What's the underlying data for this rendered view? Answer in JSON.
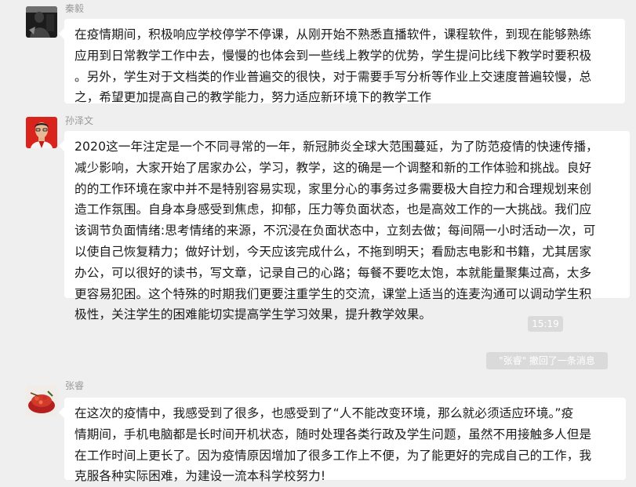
{
  "messages": [
    {
      "sender": "秦毅",
      "avatar_icon": "user-photo-dark",
      "text": "在疫情期间，积极响应学校停学不停课，从刚开始不熟悉直播软件，课程软件，到现在能够熟练\n应用到日常教学工作中去，慢慢的也体会到一些线上教学的优势，学生提问比线下教学时要积极\n。另外，学生对于文档类的作业普遍交的很快，对于需要手写分析等作业上交速度普遍较慢，总\n之，希望更加提高自己的教学能力，努力适应新环境下的教学工作"
    },
    {
      "sender": "孙泽文",
      "avatar_icon": "user-photo-red-bg",
      "text": "2020这一年注定是一个不同寻常的一年，新冠肺炎全球大范围蔓延，为了防范疫情的快速传播，\n减少影响，大家开始了居家办公，学习，教学，这的确是一个调整和新的工作体验和挑战。良好\n的的工作环境在家中并不是特别容易实现，家里分心的事务过多需要极大自控力和合理规划来创\n造工作氛围。自身本身感受到焦虑，抑郁，压力等负面状态，也是高效工作的一大挑战。我们应\n该调节负面情绪:思考情绪的来源，不沉浸在负面状态中，立刻去做；每间隔一小时活动一次，可\n以使自己恢复精力；做好计划，今天应该完成什么，不拖到明天；看励志电影和书籍，尤其居家\n办公，可以很好的读书，写文章，记录自己的心路；每餐不要吃太饱，本就能量聚集过高，太多\n更容易犯困。这个特殊的时期我们更要注重学生的交流，课堂上适当的连麦沟通可以调动学生积\n极性，关注学生的困难能切实提高学生学习效果，提升教学效果。"
    },
    {
      "sender": "张睿",
      "avatar_icon": "user-photo-food",
      "text": "在这次的疫情中，我感受到了很多，也感受到了“人不能改变环境，那么就必须适应环境。”疫\n情期间，手机电脑都是长时间开机状态，随时处理各类行政及学生问题，虽然不用接触多人但是\n在工作时间上更长了。因为疫情原因增加了很多工作上不便，为了能更好的完成自己的工作，我\n克服各种实际困难，为建设一流本科学校努力!"
    }
  ],
  "timestamp": "15:19",
  "system_notice": "\"张睿\" 撤回了一条消息",
  "colors": {
    "background": "#efefef",
    "bubble": "#ffffff",
    "sender_name": "#999999",
    "chip": "#dadada"
  }
}
